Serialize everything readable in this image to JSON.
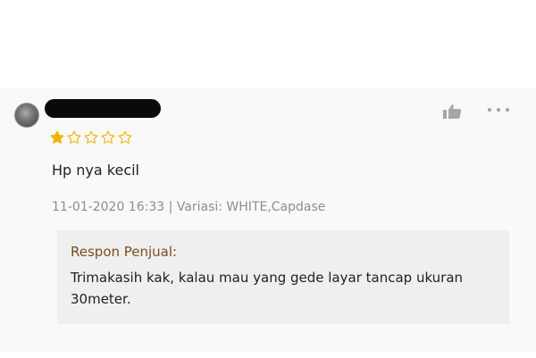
{
  "review": {
    "rating": 1,
    "max_rating": 5,
    "text": "Hp nya kecil",
    "meta": "11-01-2020 16:33 | Variasi: WHITE,Capdase",
    "icons": {
      "like": "thumbs-up-icon",
      "more": "more-icon"
    }
  },
  "seller_response": {
    "title": "Respon Penjual:",
    "text": "Trimakasih kak, kalau mau yang gede layar tancap ukuran 30meter."
  },
  "colors": {
    "star": "#f0b400",
    "seller_title": "#7a4f1c"
  }
}
